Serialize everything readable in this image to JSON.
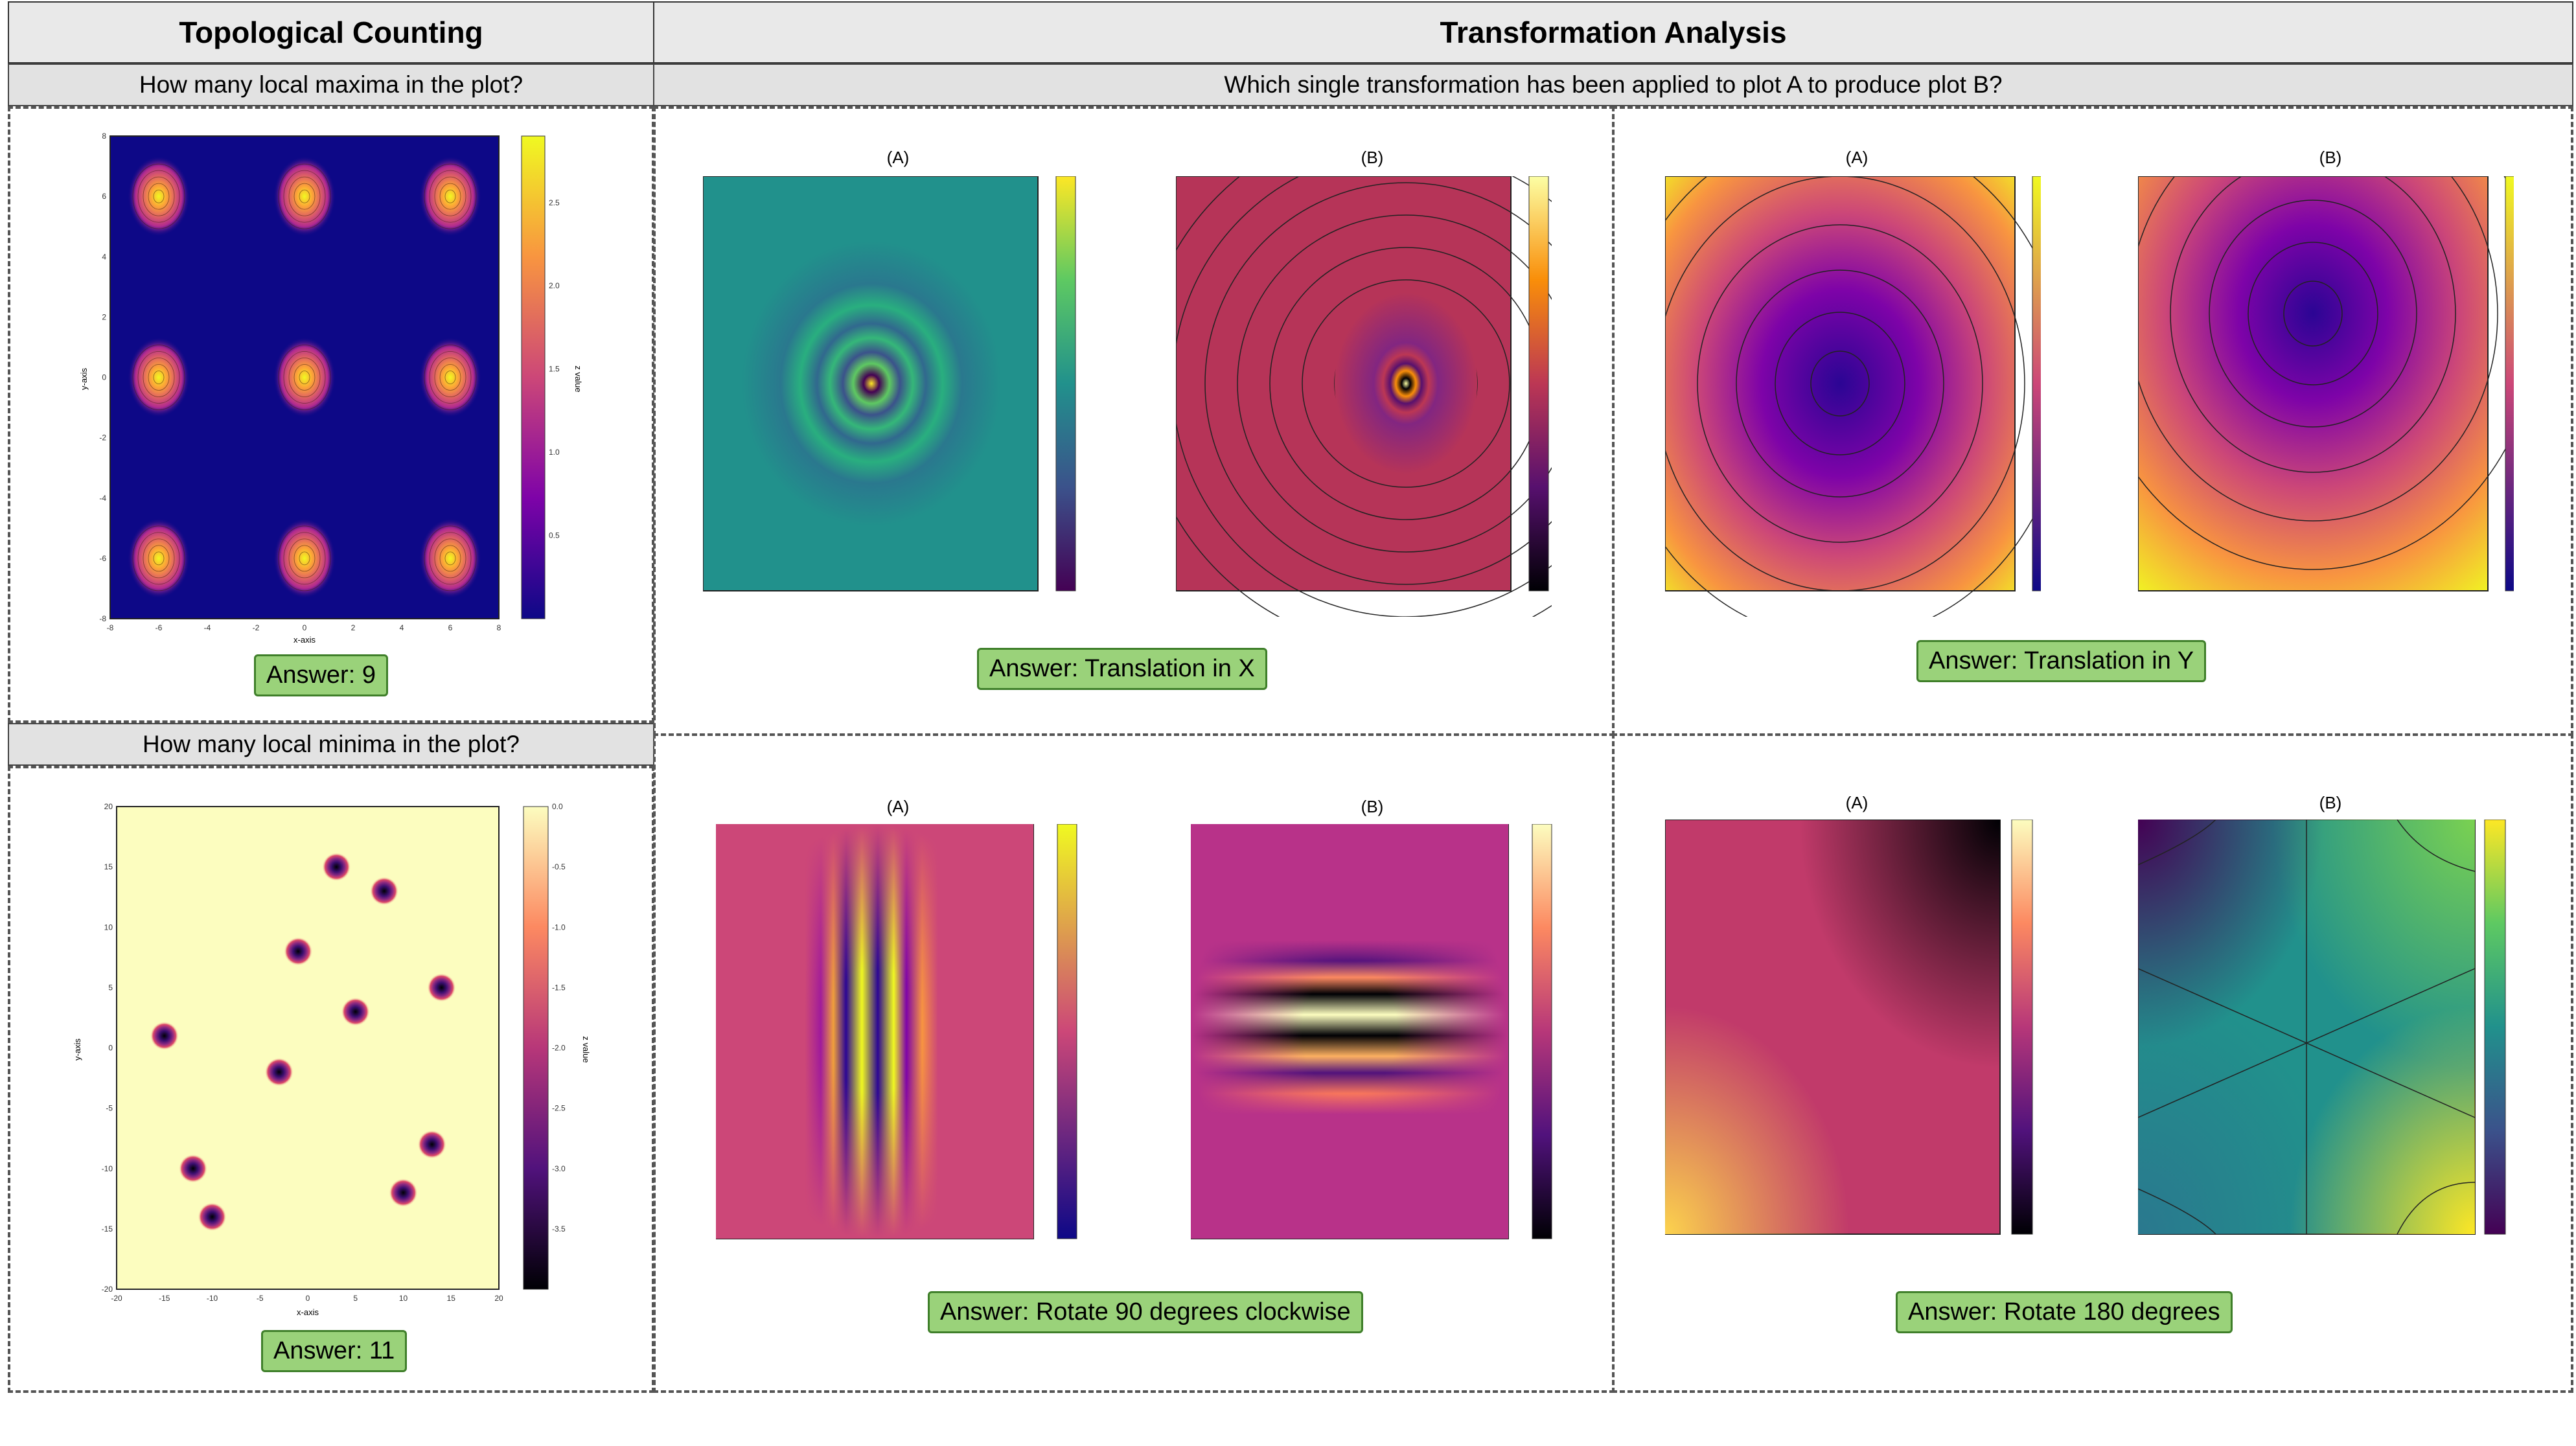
{
  "headers": {
    "left": "Topological Counting",
    "right": "Transformation Analysis"
  },
  "questions": {
    "maxima": "How many local maxima in the plot?",
    "minima": "How many local minima in the plot?",
    "transform": "Which single transformation has been applied to plot A to produce plot B?"
  },
  "answers": {
    "maxima": "Answer: 9",
    "minima": "Answer: 11",
    "tr_x": "Answer: Translation in X",
    "tr_y": "Answer: Translation in Y",
    "rot90": "Answer: Rotate 90 degrees clockwise",
    "rot180": "Answer: Rotate 180 degrees"
  },
  "panel_titles": {
    "a": "(A)",
    "b": "(B)"
  },
  "axis_labels": {
    "x": "x-axis",
    "y": "y-axis",
    "z": "z value"
  },
  "colors": {
    "header_bg": "#e9e9e9",
    "answer_bg": "#9ad27a",
    "answer_border": "#3f7f2a",
    "plasma_bg": "#0d0887",
    "magma_light": "#fcfdbf"
  },
  "chart_data": [
    {
      "type": "heatmap",
      "name": "local maxima plot",
      "x_ticks": [
        "-8",
        "-6",
        "-4",
        "-2",
        "0",
        "2",
        "4",
        "6",
        "8"
      ],
      "y_ticks": [
        "-8",
        "-6",
        "-4",
        "-2",
        "0",
        "2",
        "4",
        "6",
        "8"
      ],
      "colorbar_ticks": [
        "0.5",
        "1.0",
        "1.5",
        "2.0",
        "2.5"
      ],
      "colormap": "plasma",
      "peaks": [
        [
          -6,
          6
        ],
        [
          0,
          6
        ],
        [
          6,
          6
        ],
        [
          -6,
          0
        ],
        [
          0,
          0
        ],
        [
          6,
          0
        ],
        [
          -6,
          -6
        ],
        [
          0,
          -6
        ],
        [
          6,
          -6
        ]
      ],
      "xlim": [
        -8,
        8
      ],
      "ylim": [
        -8,
        8
      ]
    },
    {
      "type": "heatmap",
      "name": "local minima plot",
      "x_ticks": [
        "-20",
        "-15",
        "-10",
        "-5",
        "0",
        "5",
        "10",
        "15",
        "20"
      ],
      "y_ticks": [
        "-20",
        "-15",
        "-10",
        "-5",
        "0",
        "5",
        "10",
        "15",
        "20"
      ],
      "colorbar_ticks": [
        "0.0",
        "-0.5",
        "-1.0",
        "-1.5",
        "-2.0",
        "-2.5",
        "-3.0",
        "-3.5"
      ],
      "colormap": "magma",
      "minima": [
        [
          3,
          15
        ],
        [
          8,
          13
        ],
        [
          -1,
          8
        ],
        [
          14,
          5
        ],
        [
          5,
          3
        ],
        [
          -15,
          1
        ],
        [
          -3,
          -2
        ],
        [
          13,
          -8
        ],
        [
          -12,
          -10
        ],
        [
          10,
          -12
        ],
        [
          -10,
          -14
        ]
      ],
      "xlim": [
        -20,
        20
      ],
      "ylim": [
        -20,
        20
      ]
    }
  ]
}
